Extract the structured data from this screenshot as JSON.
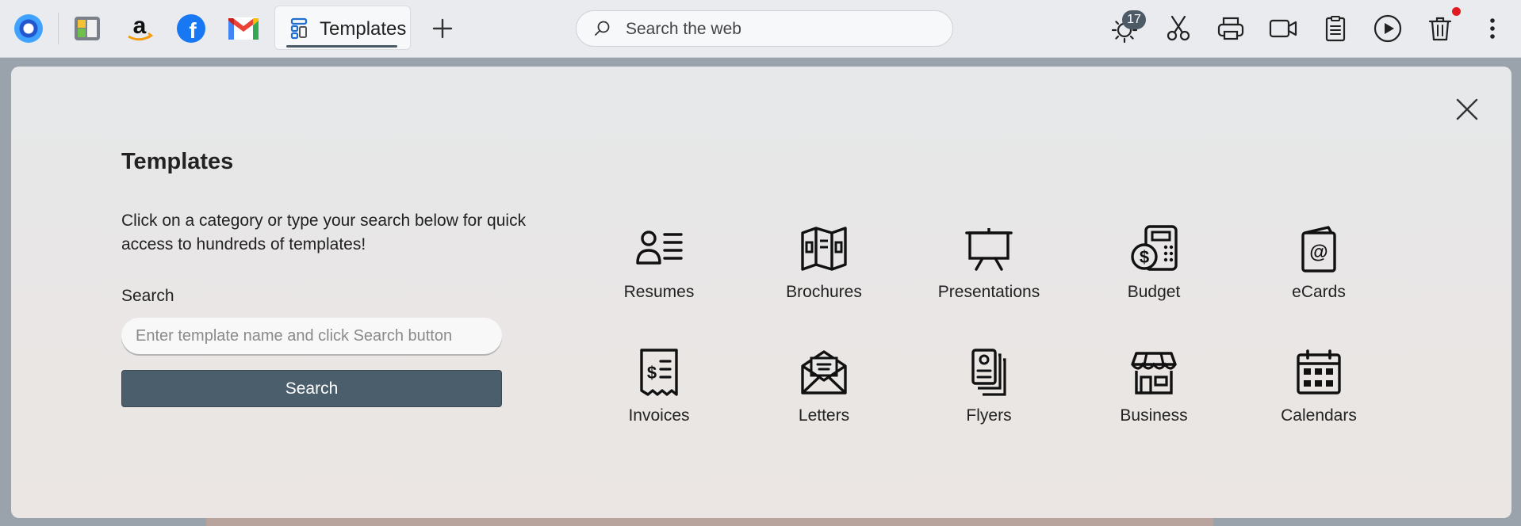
{
  "toolbar": {
    "tabs": [
      {
        "name": "app-logo",
        "icon": "app-logo-icon"
      },
      {
        "name": "sidebar-toggle",
        "icon": "panel-icon"
      },
      {
        "name": "amazon-shortcut",
        "icon": "amazon-icon"
      },
      {
        "name": "facebook-shortcut",
        "icon": "facebook-icon"
      },
      {
        "name": "gmail-shortcut",
        "icon": "gmail-icon"
      }
    ],
    "active_tab": {
      "label": "Templates",
      "icon": "templates-icon"
    },
    "new_tab_icon": "plus-icon",
    "search_placeholder": "Search the web",
    "weather_badge": "17",
    "actions": [
      "weather-icon",
      "scissors-icon",
      "printer-icon",
      "video-camera-icon",
      "clipboard-icon",
      "play-icon",
      "trash-icon",
      "more-vertical-icon"
    ]
  },
  "panel": {
    "title": "Templates",
    "description": "Click on a category or type your search below for quick access to hundreds of templates!",
    "search_label": "Search",
    "search_placeholder": "Enter template name and click Search button",
    "search_value": "",
    "search_button": "Search",
    "close_icon": "close-icon",
    "categories": [
      {
        "label": "Resumes",
        "icon": "resume-icon"
      },
      {
        "label": "Brochures",
        "icon": "brochure-icon"
      },
      {
        "label": "Presentations",
        "icon": "presentation-icon"
      },
      {
        "label": "Budget",
        "icon": "budget-icon"
      },
      {
        "label": "eCards",
        "icon": "ecard-icon"
      },
      {
        "label": "Invoices",
        "icon": "invoice-icon"
      },
      {
        "label": "Letters",
        "icon": "letter-icon"
      },
      {
        "label": "Flyers",
        "icon": "flyer-icon"
      },
      {
        "label": "Business",
        "icon": "storefront-icon"
      },
      {
        "label": "Calendars",
        "icon": "calendar-icon"
      }
    ]
  },
  "colors": {
    "toolbar_bg": "#e9ebee",
    "panel_bg": "#e7e8e9",
    "search_button": "#4b5e6b",
    "badge": "#4d5b67",
    "notification_dot": "#e21b22"
  }
}
